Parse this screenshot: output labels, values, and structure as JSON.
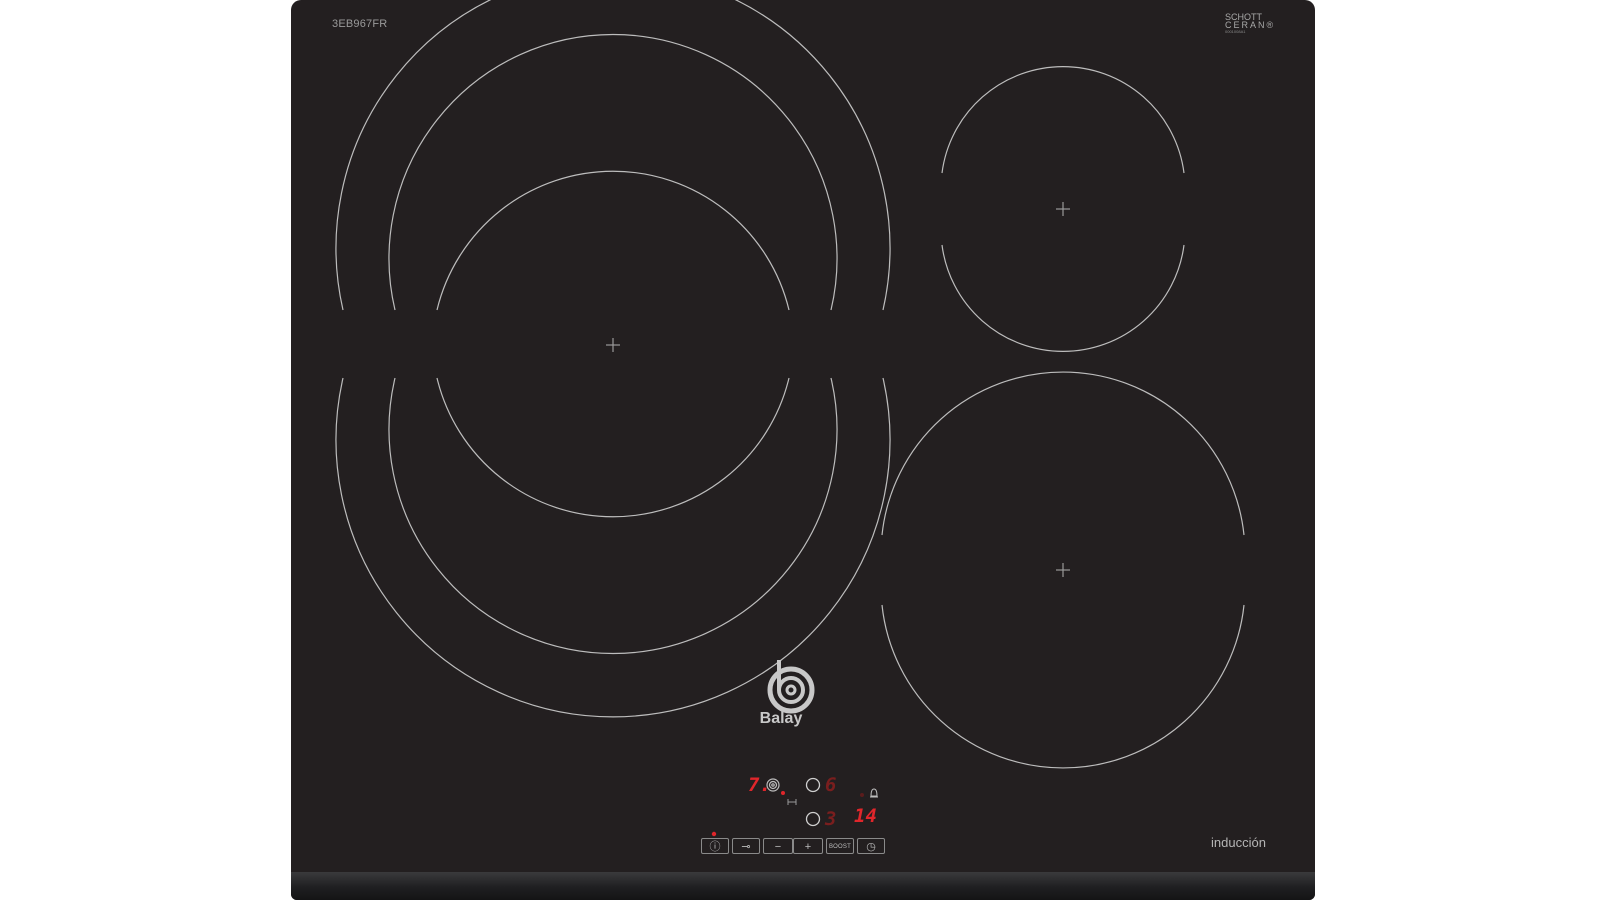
{
  "product": {
    "model": "3EB967FR",
    "glass_brand_line1": "SCHOTT",
    "glass_brand_line2": "CERAN®",
    "glass_code": "0001008A1",
    "brand": "Balay",
    "type_label": "inducción"
  },
  "display": {
    "left_power": "7.",
    "right_top": "6",
    "right_bottom": "3",
    "timer": "14"
  },
  "controls": {
    "info": "ⓘ",
    "lock": "⊸",
    "minus": "−",
    "plus": "+",
    "boost": "BOOST",
    "timer": "◷"
  },
  "colors": {
    "glass": "#231f20",
    "zone_outline": "#bdbdbd",
    "display_red": "#e0262b"
  }
}
